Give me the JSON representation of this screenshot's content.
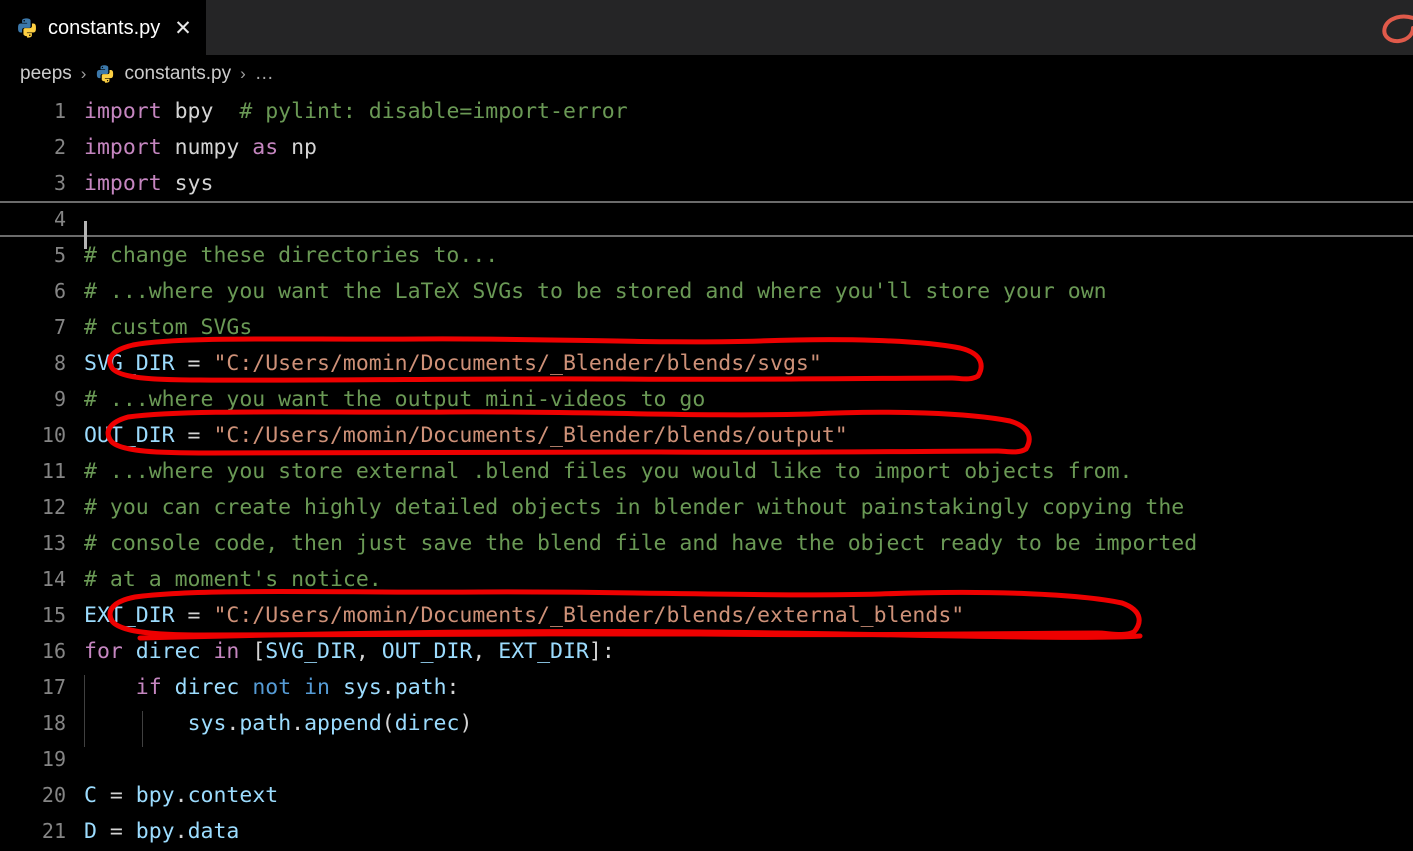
{
  "window": {
    "app": "Visual Studio Code",
    "theme_background": "#000000",
    "tabbar_background": "#252526"
  },
  "tabbar": {
    "tabs": [
      {
        "label": "constants.py",
        "icon": "python-file-icon",
        "close_label": "✕",
        "active": true
      }
    ]
  },
  "breadcrumb": {
    "separator": "›",
    "items": [
      {
        "label": "peeps",
        "icon": null
      },
      {
        "label": "constants.py",
        "icon": "python-file-icon"
      },
      {
        "label": "…",
        "icon": null
      }
    ]
  },
  "editor": {
    "language": "python",
    "cursor_line": 4,
    "active_line_number": "4",
    "colors": {
      "keyword": "#c586c0",
      "keyword_operator": "#569cd6",
      "comment": "#6a9955",
      "string": "#ce9178",
      "variable": "#9cdcfe",
      "plain": "#d4d4d4",
      "line_number": "#858585",
      "annotation_red": "#ee0000"
    },
    "lines": [
      {
        "num": "1",
        "tokens": [
          {
            "t": "import",
            "c": "kw"
          },
          {
            "t": " bpy  ",
            "c": "plain"
          },
          {
            "t": "# pylint: disable=import-error",
            "c": "cmt"
          }
        ]
      },
      {
        "num": "2",
        "tokens": [
          {
            "t": "import",
            "c": "kw"
          },
          {
            "t": " numpy ",
            "c": "plain"
          },
          {
            "t": "as",
            "c": "kw"
          },
          {
            "t": " np",
            "c": "plain"
          }
        ]
      },
      {
        "num": "3",
        "tokens": [
          {
            "t": "import",
            "c": "kw"
          },
          {
            "t": " sys",
            "c": "plain"
          }
        ]
      },
      {
        "num": "4",
        "tokens": []
      },
      {
        "num": "5",
        "tokens": [
          {
            "t": "# change these directories to...",
            "c": "cmt"
          }
        ]
      },
      {
        "num": "6",
        "tokens": [
          {
            "t": "# ...where you want the LaTeX SVGs to be stored and where you'll store your own",
            "c": "cmt"
          }
        ]
      },
      {
        "num": "7",
        "tokens": [
          {
            "t": "# custom SVGs",
            "c": "cmt"
          }
        ]
      },
      {
        "num": "8",
        "tokens": [
          {
            "t": "SVG_DIR",
            "c": "var"
          },
          {
            "t": " = ",
            "c": "plain"
          },
          {
            "t": "\"C:/Users/momin/Documents/_Blender/blends/svgs\"",
            "c": "str"
          }
        ]
      },
      {
        "num": "9",
        "tokens": [
          {
            "t": "# ...where you want the output mini-videos to go",
            "c": "cmt"
          }
        ]
      },
      {
        "num": "10",
        "tokens": [
          {
            "t": "OUT_DIR",
            "c": "var"
          },
          {
            "t": " = ",
            "c": "plain"
          },
          {
            "t": "\"C:/Users/momin/Documents/_Blender/blends/output\"",
            "c": "str"
          }
        ]
      },
      {
        "num": "11",
        "tokens": [
          {
            "t": "# ...where you store external .blend files you would like to import objects from.",
            "c": "cmt"
          }
        ]
      },
      {
        "num": "12",
        "tokens": [
          {
            "t": "# you can create highly detailed objects in blender without painstakingly copying the",
            "c": "cmt"
          }
        ]
      },
      {
        "num": "13",
        "tokens": [
          {
            "t": "# console code, then just save the blend file and have the object ready to be imported",
            "c": "cmt"
          }
        ]
      },
      {
        "num": "14",
        "tokens": [
          {
            "t": "# at a moment's notice.",
            "c": "cmt"
          }
        ]
      },
      {
        "num": "15",
        "tokens": [
          {
            "t": "EXT_DIR",
            "c": "var"
          },
          {
            "t": " = ",
            "c": "plain"
          },
          {
            "t": "\"C:/Users/momin/Documents/_Blender/blends/external_blends\"",
            "c": "str"
          }
        ]
      },
      {
        "num": "16",
        "tokens": [
          {
            "t": "for",
            "c": "kw"
          },
          {
            "t": " ",
            "c": "plain"
          },
          {
            "t": "direc",
            "c": "var"
          },
          {
            "t": " ",
            "c": "plain"
          },
          {
            "t": "in",
            "c": "kw"
          },
          {
            "t": " [",
            "c": "plain"
          },
          {
            "t": "SVG_DIR",
            "c": "var"
          },
          {
            "t": ", ",
            "c": "plain"
          },
          {
            "t": "OUT_DIR",
            "c": "var"
          },
          {
            "t": ", ",
            "c": "plain"
          },
          {
            "t": "EXT_DIR",
            "c": "var"
          },
          {
            "t": "]:",
            "c": "plain"
          }
        ]
      },
      {
        "num": "17",
        "indent": 1,
        "tokens": [
          {
            "t": "    ",
            "c": "plain"
          },
          {
            "t": "if",
            "c": "kw"
          },
          {
            "t": " ",
            "c": "plain"
          },
          {
            "t": "direc",
            "c": "var"
          },
          {
            "t": " ",
            "c": "plain"
          },
          {
            "t": "not",
            "c": "kwb"
          },
          {
            "t": " ",
            "c": "plain"
          },
          {
            "t": "in",
            "c": "kwb"
          },
          {
            "t": " ",
            "c": "plain"
          },
          {
            "t": "sys",
            "c": "var"
          },
          {
            "t": ".",
            "c": "plain"
          },
          {
            "t": "path",
            "c": "var"
          },
          {
            "t": ":",
            "c": "plain"
          }
        ]
      },
      {
        "num": "18",
        "indent": 2,
        "tokens": [
          {
            "t": "        ",
            "c": "plain"
          },
          {
            "t": "sys",
            "c": "var"
          },
          {
            "t": ".",
            "c": "plain"
          },
          {
            "t": "path",
            "c": "var"
          },
          {
            "t": ".",
            "c": "plain"
          },
          {
            "t": "append",
            "c": "var"
          },
          {
            "t": "(",
            "c": "plain"
          },
          {
            "t": "direc",
            "c": "var"
          },
          {
            "t": ")",
            "c": "plain"
          }
        ]
      },
      {
        "num": "19",
        "tokens": []
      },
      {
        "num": "20",
        "tokens": [
          {
            "t": "C",
            "c": "var"
          },
          {
            "t": " = ",
            "c": "plain"
          },
          {
            "t": "bpy",
            "c": "var"
          },
          {
            "t": ".",
            "c": "plain"
          },
          {
            "t": "context",
            "c": "var"
          }
        ]
      },
      {
        "num": "21",
        "tokens": [
          {
            "t": "D",
            "c": "var"
          },
          {
            "t": " = ",
            "c": "plain"
          },
          {
            "t": "bpy",
            "c": "var"
          },
          {
            "t": ".",
            "c": "plain"
          },
          {
            "t": "data",
            "c": "var"
          }
        ]
      }
    ]
  },
  "annotations": {
    "color": "#ee0000",
    "stroke_width": 5,
    "shapes": [
      {
        "name": "circle-svg-dir-line",
        "target_line": "8"
      },
      {
        "name": "circle-out-dir-line",
        "target_line": "10"
      },
      {
        "name": "circle-ext-dir-line",
        "target_line": "15"
      },
      {
        "name": "partial-stroke-top-right",
        "target_line": null
      }
    ]
  }
}
